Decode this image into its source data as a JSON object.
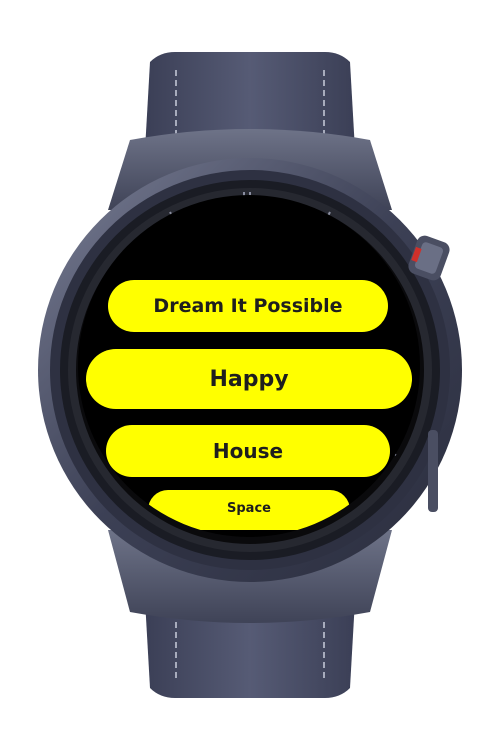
{
  "watch": {
    "case_color": "#3a3e52",
    "strap_color": "#4b5068",
    "screen_bg": "#000000",
    "crown_accent": "#d0302a"
  },
  "list": {
    "item_color": "#ffff00",
    "text_color": "#1e1e1e",
    "items": [
      {
        "label": "Dream It Possible"
      },
      {
        "label": "Happy"
      },
      {
        "label": "House"
      },
      {
        "label": "Space"
      }
    ]
  }
}
